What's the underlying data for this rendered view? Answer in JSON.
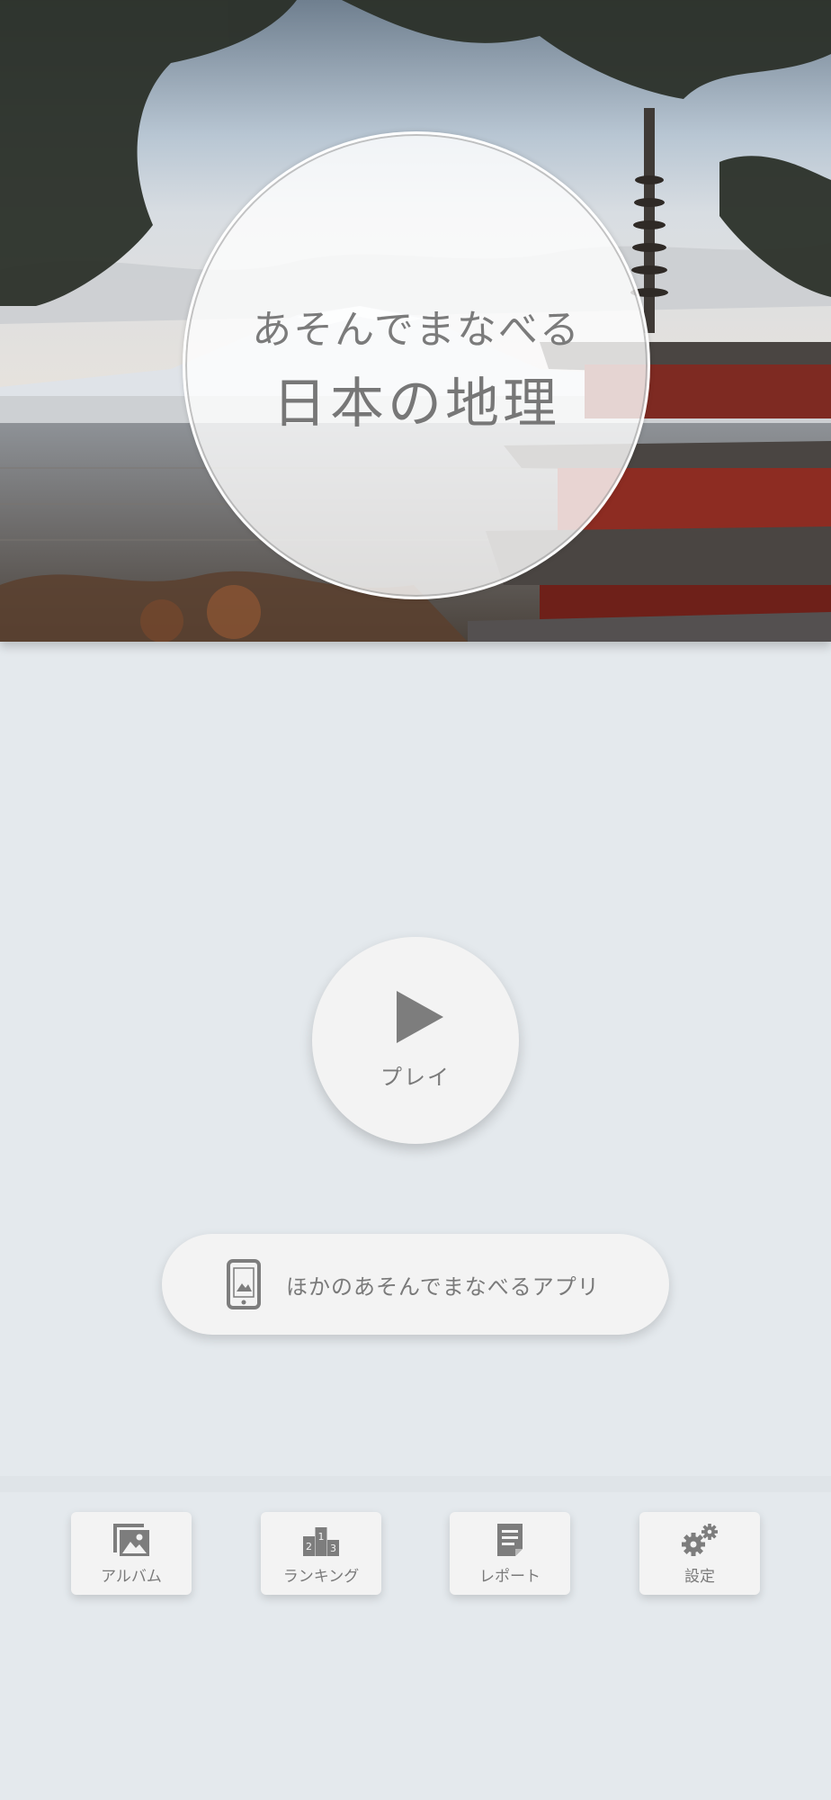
{
  "hero": {
    "subtitle": "あそんでまなべる",
    "title": "日本の地理"
  },
  "play": {
    "label": "プレイ",
    "icon": "play-icon"
  },
  "other_apps": {
    "label": "ほかのあそんでまなべるアプリ",
    "icon": "smartphone-icon"
  },
  "nav": {
    "items": [
      {
        "label": "アルバム",
        "icon": "album-icon"
      },
      {
        "label": "ランキング",
        "icon": "ranking-podium-icon"
      },
      {
        "label": "レポート",
        "icon": "report-icon"
      },
      {
        "label": "設定",
        "icon": "gear-icon"
      }
    ]
  },
  "colors": {
    "background": "#e4e9ed",
    "button": "#f3f3f3",
    "text": "#7a7a7a",
    "icon": "#7d7d7d"
  }
}
